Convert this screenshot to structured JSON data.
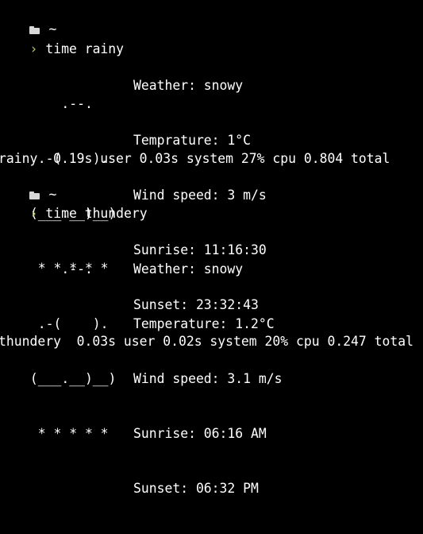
{
  "colors": {
    "background": "#000000",
    "text": "#ffffff",
    "prompt_accent": "#b7cd62"
  },
  "blocks": [
    {
      "dir": "~",
      "prompt_symbol": "›",
      "command": "time rainy",
      "art": [
        "     .--.    ",
        "  .-(    ).  ",
        " (___.__)__) ",
        "  * * * * *  "
      ],
      "info": {
        "weather": "Weather: snowy",
        "temperature": "Temprature: 1°C",
        "wind": "Wind speed: 3 m/s",
        "sunrise": "Sunrise: 11:16:30",
        "sunset": "Sunset: 23:32:43"
      },
      "timing": "rainy  0.19s user 0.03s system 27% cpu 0.804 total"
    },
    {
      "dir": "~",
      "prompt_symbol": "›",
      "command": "time thundery",
      "art": [
        "     .--.    ",
        "  .-(    ).  ",
        " (___.__)__) ",
        "  * * * * *  "
      ],
      "info": {
        "weather": "Weather: snowy",
        "temperature": "Temperature: 1.2°C",
        "wind": "Wind speed: 3.1 m/s",
        "sunrise": "Sunrise: 06:16 AM",
        "sunset": "Sunset: 06:32 PM"
      },
      "timing": "thundery  0.03s user 0.02s system 20% cpu 0.247 total"
    }
  ]
}
